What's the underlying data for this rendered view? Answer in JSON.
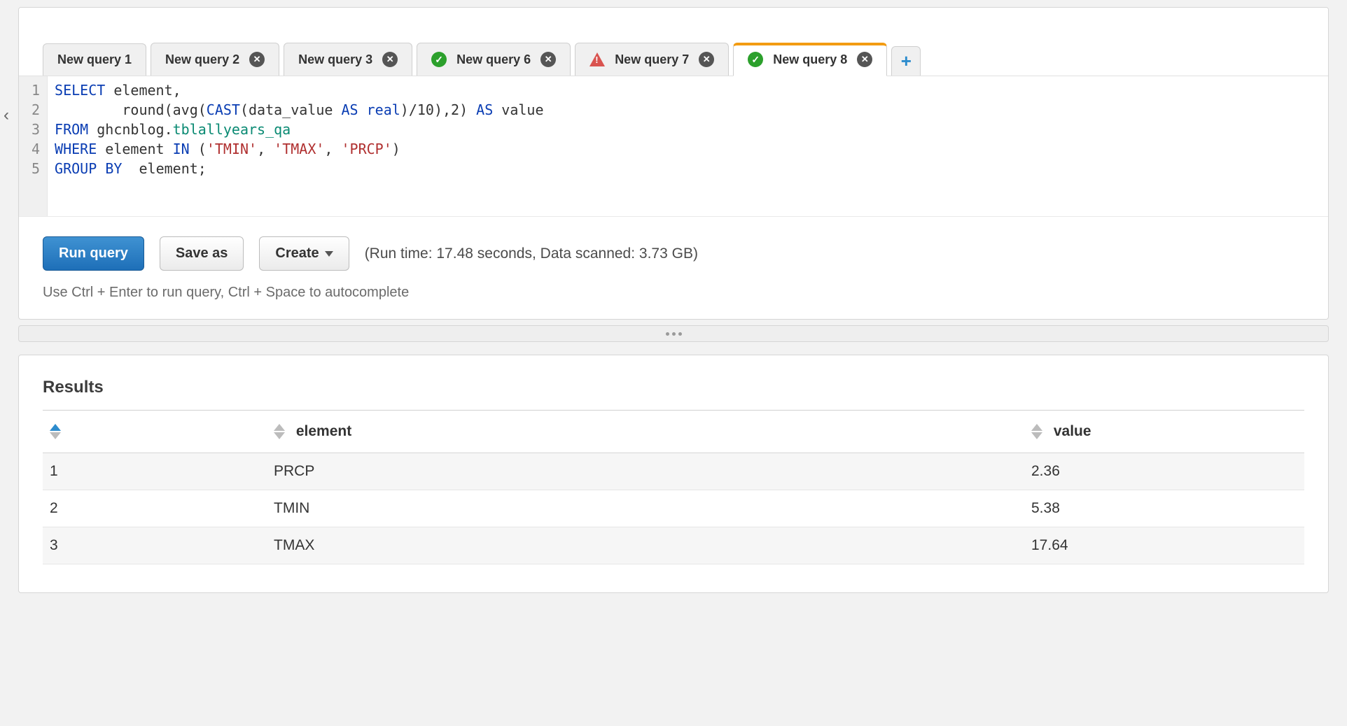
{
  "collapse_glyph": "‹",
  "tabs": [
    {
      "label": "New query 1",
      "closeable": false,
      "status": null,
      "active": false
    },
    {
      "label": "New query 2",
      "closeable": true,
      "status": null,
      "active": false
    },
    {
      "label": "New query 3",
      "closeable": true,
      "status": null,
      "active": false
    },
    {
      "label": "New query 6",
      "closeable": true,
      "status": "success",
      "active": false
    },
    {
      "label": "New query 7",
      "closeable": true,
      "status": "error",
      "active": false
    },
    {
      "label": "New query 8",
      "closeable": true,
      "status": "success",
      "active": true
    }
  ],
  "editor": {
    "lines": [
      [
        {
          "t": "kw",
          "v": "SELECT"
        },
        {
          "t": "p",
          "v": " element,"
        }
      ],
      [
        {
          "t": "p",
          "v": "        round(avg("
        },
        {
          "t": "kw",
          "v": "CAST"
        },
        {
          "t": "p",
          "v": "(data_value "
        },
        {
          "t": "kw",
          "v": "AS"
        },
        {
          "t": "p",
          "v": " "
        },
        {
          "t": "kw",
          "v": "real"
        },
        {
          "t": "p",
          "v": ")/10),2) "
        },
        {
          "t": "kw",
          "v": "AS"
        },
        {
          "t": "p",
          "v": " value"
        }
      ],
      [
        {
          "t": "kw",
          "v": "FROM"
        },
        {
          "t": "p",
          "v": " ghcnblog."
        },
        {
          "t": "id",
          "v": "tblallyears_qa"
        }
      ],
      [
        {
          "t": "kw",
          "v": "WHERE"
        },
        {
          "t": "p",
          "v": " element "
        },
        {
          "t": "kw",
          "v": "IN"
        },
        {
          "t": "p",
          "v": " ("
        },
        {
          "t": "str",
          "v": "'TMIN'"
        },
        {
          "t": "p",
          "v": ", "
        },
        {
          "t": "str",
          "v": "'TMAX'"
        },
        {
          "t": "p",
          "v": ", "
        },
        {
          "t": "str",
          "v": "'PRCP'"
        },
        {
          "t": "p",
          "v": ")"
        }
      ],
      [
        {
          "t": "kw",
          "v": "GROUP"
        },
        {
          "t": "p",
          "v": " "
        },
        {
          "t": "kw",
          "v": "BY"
        },
        {
          "t": "p",
          "v": "  element;"
        }
      ]
    ]
  },
  "toolbar": {
    "run_label": "Run query",
    "save_label": "Save as",
    "create_label": "Create",
    "stats": "(Run time: 17.48 seconds, Data scanned: 3.73 GB)"
  },
  "hint": "Use Ctrl + Enter to run query, Ctrl + Space to autocomplete",
  "results": {
    "title": "Results",
    "columns": [
      "",
      "element",
      "value"
    ],
    "rows": [
      {
        "n": "1",
        "element": "PRCP",
        "value": "2.36"
      },
      {
        "n": "2",
        "element": "TMIN",
        "value": "5.38"
      },
      {
        "n": "3",
        "element": "TMAX",
        "value": "17.64"
      }
    ]
  }
}
